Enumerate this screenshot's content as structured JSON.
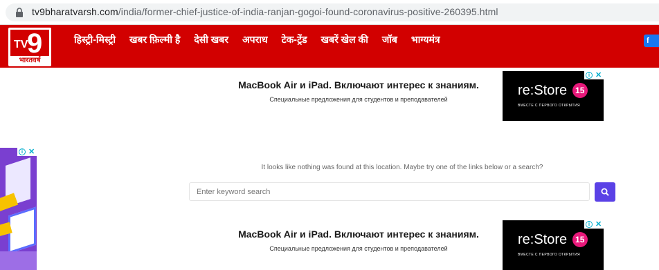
{
  "browser": {
    "url_domain": "tv9bharatvarsh.com",
    "url_path": "/india/former-chief-justice-of-india-ranjan-gogoi-found-coronavirus-positive-260395.html",
    "lock_icon": "lock-icon"
  },
  "header": {
    "logo_tv": "TV",
    "logo_number": "9",
    "logo_subtitle": "भारतवर्ष",
    "brand_color": "#d20000",
    "nav_items": [
      {
        "label": "हिस्ट्री-मिस्ट्री"
      },
      {
        "label": "खबर फ़िल्मी है"
      },
      {
        "label": "देसी खबर"
      },
      {
        "label": "अपराध"
      },
      {
        "label": "टेक-ट्रेंड"
      },
      {
        "label": "खबरें खेल की"
      },
      {
        "label": "जॉब"
      },
      {
        "label": "भाग्यमंत्र"
      }
    ],
    "facebook_label": "f"
  },
  "ads": [
    {
      "title": "MacBook Air и iPad. Включают интерес к знаниям.",
      "subtitle": "Специальные предложения для студентов и преподавателей",
      "brand": "re:Store",
      "badge": "15",
      "tagline": "ВМЕСТЕ С ПЕРВОГО ОТКРЫТИЯ"
    },
    {
      "title": "MacBook Air и iPad. Включают интерес к знаниям.",
      "subtitle": "Специальные предложения для студентов и преподавателей",
      "brand": "re:Store",
      "badge": "15",
      "tagline": "ВМЕСТЕ С ПЕРВОГО ОТКРЫТИЯ"
    }
  ],
  "adchoices": {
    "info": "i",
    "close": "✕"
  },
  "main": {
    "not_found_message": "It looks like nothing was found at this location. Maybe try one of the links below or a search?",
    "search_placeholder": "Enter keyword search",
    "search_button_color": "#5a41e6"
  }
}
